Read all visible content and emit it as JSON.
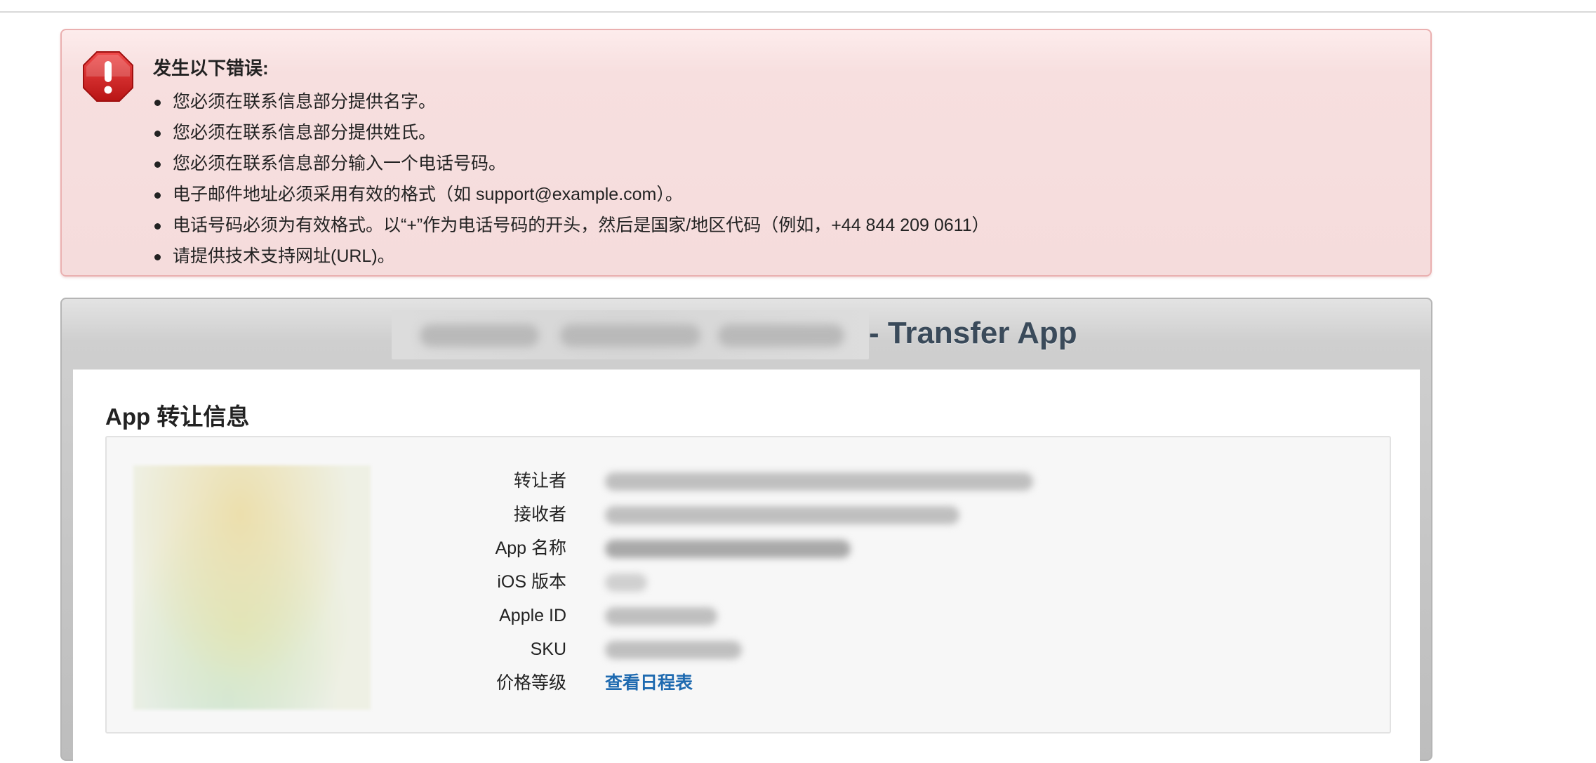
{
  "error": {
    "title": "发生以下错误:",
    "items": [
      "您必须在联系信息部分提供名字。",
      "您必须在联系信息部分提供姓氏。",
      "您必须在联系信息部分输入一个电话号码。",
      "电子邮件地址必须采用有效的格式（如 support@example.com）。",
      "电话号码必须为有效格式。以“+”作为电话号码的开头，然后是国家/地区代码（例如，+44 844 209 0611）",
      "请提供技术支持网址(URL)。"
    ],
    "icon": "error-octagon-icon",
    "colors": {
      "background": "#f7dfdf",
      "border": "#eab0b0",
      "icon": "#cc1f1f"
    }
  },
  "panel": {
    "title_suffix": "- Transfer App",
    "section_title": "App 转让信息",
    "fields": {
      "transferor_label": "转让者",
      "recipient_label": "接收者",
      "app_name_label": "App 名称",
      "ios_version_label": "iOS 版本",
      "apple_id_label": "Apple ID",
      "sku_label": "SKU",
      "price_tier_label": "价格等级",
      "price_tier_link": "查看日程表"
    },
    "colors": {
      "title": "#3a4a5a",
      "link": "#1e6ab0"
    }
  }
}
